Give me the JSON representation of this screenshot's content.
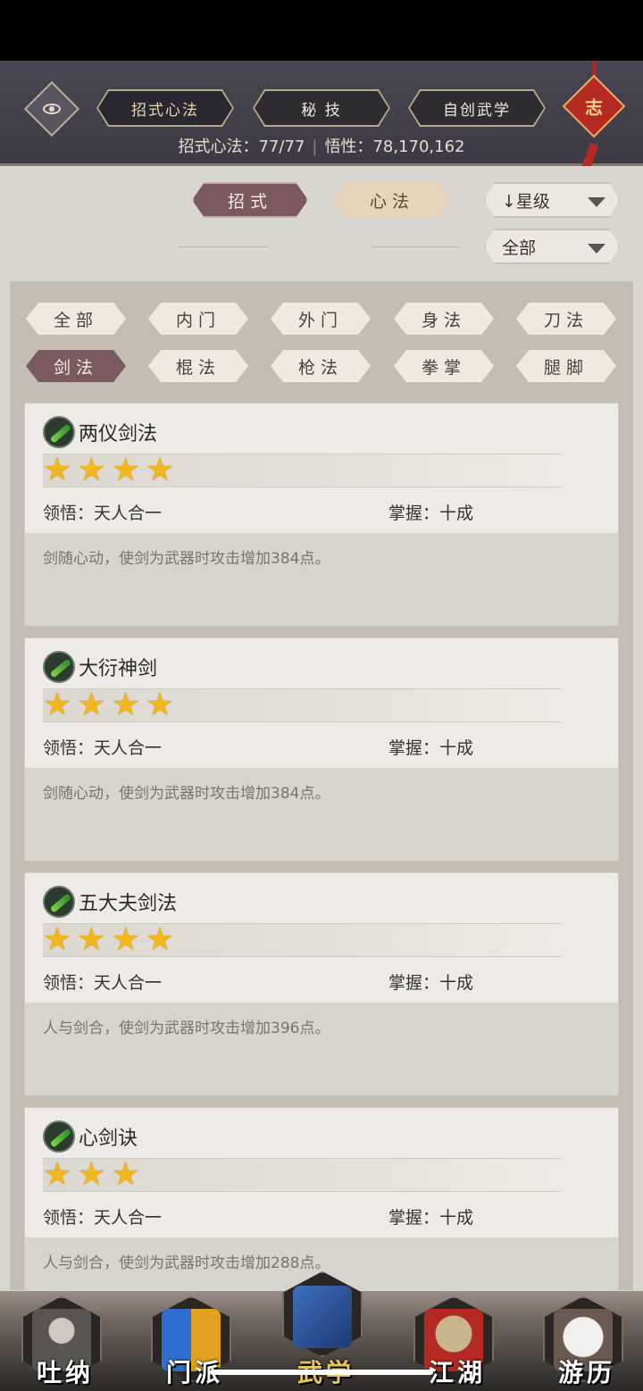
{
  "header": {
    "tabs": [
      {
        "label": "招式心法",
        "active": true
      },
      {
        "label": "秘 技",
        "active": false
      },
      {
        "label": "自创武学",
        "active": false
      }
    ],
    "stats": {
      "moves_label": "招式心法：",
      "moves_value": "77/77",
      "insight_label": "悟性：",
      "insight_value": "78,170,162"
    },
    "knot_char": "志"
  },
  "sub_tabs": [
    {
      "label": "招式",
      "active": true
    },
    {
      "label": "心法",
      "active": false
    }
  ],
  "sort_dropdown": {
    "value": "↓星级"
  },
  "filter_dropdown": {
    "value": "全部"
  },
  "filters": [
    {
      "label": "全部",
      "active": false
    },
    {
      "label": "内门",
      "active": false
    },
    {
      "label": "外门",
      "active": false
    },
    {
      "label": "身法",
      "active": false
    },
    {
      "label": "刀法",
      "active": false
    },
    {
      "label": "剑法",
      "active": true
    },
    {
      "label": "棍法",
      "active": false
    },
    {
      "label": "枪法",
      "active": false
    },
    {
      "label": "拳掌",
      "active": false
    },
    {
      "label": "腿脚",
      "active": false
    }
  ],
  "skills": [
    {
      "name": "两仪剑法",
      "stars": 4,
      "comprehension": "领悟：天人合一",
      "mastery": "掌握：十成",
      "desc": "剑随心动，使剑为武器时攻击增加384点。"
    },
    {
      "name": "大衍神剑",
      "stars": 4,
      "comprehension": "领悟：天人合一",
      "mastery": "掌握：十成",
      "desc": "剑随心动，使剑为武器时攻击增加384点。"
    },
    {
      "name": "五大夫剑法",
      "stars": 4,
      "comprehension": "领悟：天人合一",
      "mastery": "掌握：十成",
      "desc": "人与剑合，使剑为武器时攻击增加396点。"
    },
    {
      "name": "心剑诀",
      "stars": 3,
      "comprehension": "领悟：天人合一",
      "mastery": "掌握：十成",
      "desc": "人与剑合，使剑为武器时攻击增加288点。"
    }
  ],
  "bottom_nav": [
    {
      "label": "吐纳",
      "active": false
    },
    {
      "label": "门派",
      "active": false
    },
    {
      "label": "武学",
      "active": true
    },
    {
      "label": "江湖",
      "active": false
    },
    {
      "label": "游历",
      "active": false
    }
  ],
  "colors": {
    "accent": "#7a5a5e",
    "star": "#f2b71c",
    "header_bg": "#3e3a45"
  }
}
